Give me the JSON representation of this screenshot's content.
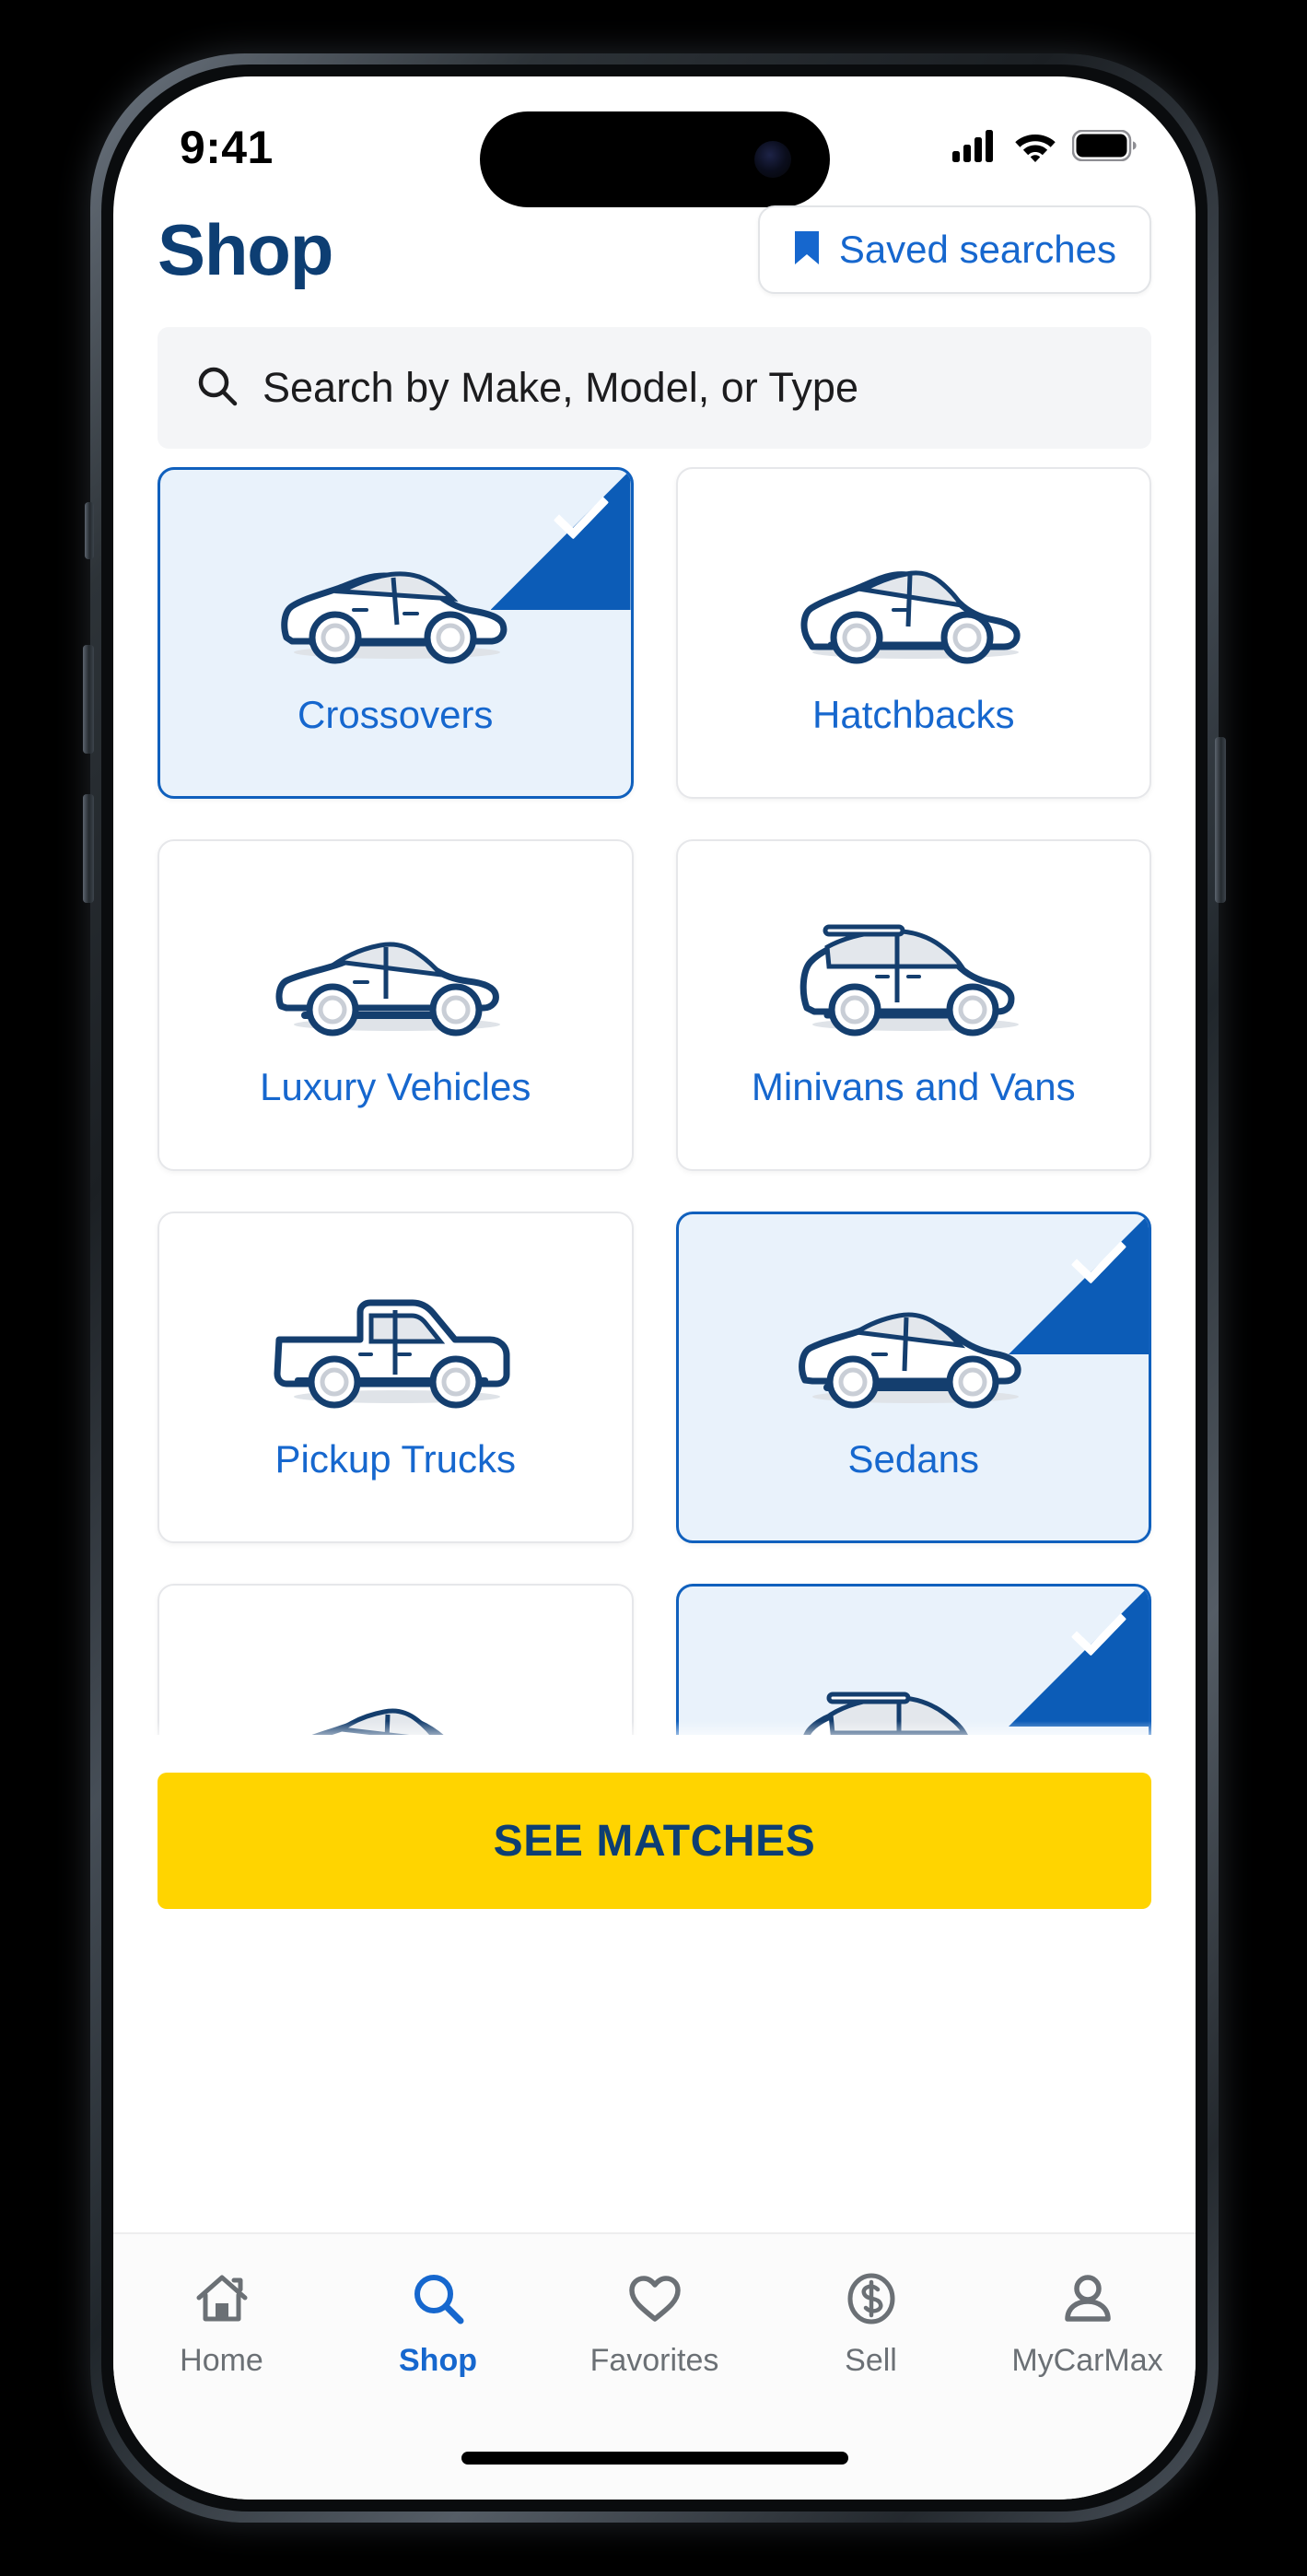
{
  "status_bar": {
    "time": "9:41",
    "icons": [
      "cellular-signal-icon",
      "wifi-icon",
      "battery-icon"
    ]
  },
  "header": {
    "title": "Shop",
    "saved_searches_label": "Saved searches",
    "saved_searches_icon": "bookmark-icon"
  },
  "search": {
    "placeholder": "Search by Make, Model, or Type",
    "value": "",
    "icon": "search-icon"
  },
  "vehicle_types": [
    {
      "label": "Crossovers",
      "art": "crossover",
      "selected": true
    },
    {
      "label": "Hatchbacks",
      "art": "hatchback",
      "selected": false
    },
    {
      "label": "Luxury Vehicles",
      "art": "luxury",
      "selected": false
    },
    {
      "label": "Minivans and Vans",
      "art": "minivan",
      "selected": false
    },
    {
      "label": "Pickup Trucks",
      "art": "pickup",
      "selected": false
    },
    {
      "label": "Sedans",
      "art": "sedan",
      "selected": true
    },
    {
      "label": "",
      "art": "coupe",
      "selected": false
    },
    {
      "label": "",
      "art": "suv",
      "selected": true
    }
  ],
  "cta": {
    "label": "SEE MATCHES"
  },
  "tab_bar": {
    "items": [
      {
        "label": "Home",
        "icon": "home-icon",
        "active": false
      },
      {
        "label": "Shop",
        "icon": "search-icon",
        "active": true
      },
      {
        "label": "Favorites",
        "icon": "heart-icon",
        "active": false
      },
      {
        "label": "Sell",
        "icon": "dollar-circle-icon",
        "active": false
      },
      {
        "label": "MyCarMax",
        "icon": "person-icon",
        "active": false
      }
    ]
  },
  "colors": {
    "brand_navy": "#0d3e73",
    "brand_blue": "#1667ce",
    "selected_blue": "#0c5cb7",
    "selected_bg": "#e9f2fb",
    "cta_yellow": "#ffd400",
    "search_bg": "#f4f5f7",
    "tab_inactive": "#6b7075"
  }
}
